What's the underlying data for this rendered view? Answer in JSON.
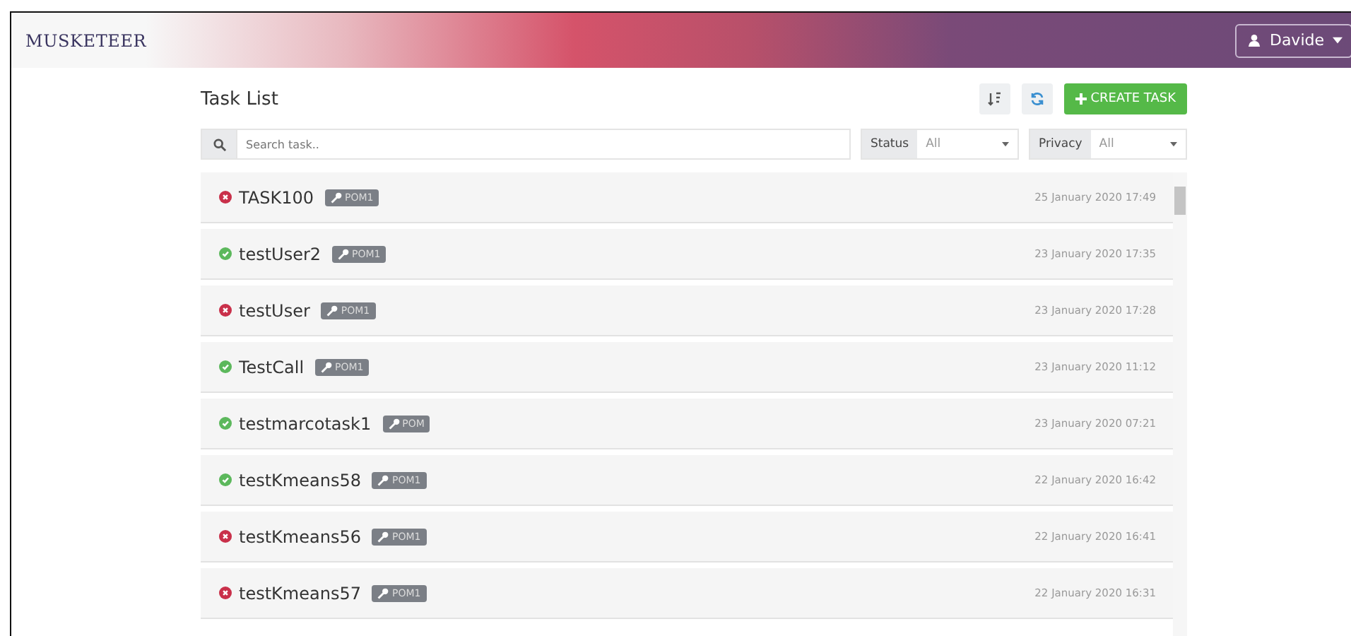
{
  "header": {
    "logo": "MUSKETEER",
    "user": "Davide"
  },
  "page": {
    "title": "Task List",
    "create_button": "CREATE TASK"
  },
  "filters": {
    "search": {
      "placeholder": "Search task.."
    },
    "status": {
      "label": "Status",
      "value": "All"
    },
    "privacy": {
      "label": "Privacy",
      "value": "All"
    }
  },
  "tasks": [
    {
      "name": "TASK100",
      "kind": "failed",
      "tag": "POM1",
      "date": "25 January 2020 17:49"
    },
    {
      "name": "testUser2",
      "kind": "done",
      "tag": "POM1",
      "date": "23 January 2020 17:35"
    },
    {
      "name": "testUser",
      "kind": "failed",
      "tag": "POM1",
      "date": "23 January 2020 17:28"
    },
    {
      "name": "TestCall",
      "kind": "done",
      "tag": "POM1",
      "date": "23 January 2020 11:12"
    },
    {
      "name": "testmarcotask1",
      "kind": "done",
      "tag": "POM",
      "date": "23 January 2020 07:21"
    },
    {
      "name": "testKmeans58",
      "kind": "done",
      "tag": "POM1",
      "date": "22 January 2020 16:42"
    },
    {
      "name": "testKmeans56",
      "kind": "failed",
      "tag": "POM1",
      "date": "22 January 2020 16:41"
    },
    {
      "name": "testKmeans57",
      "kind": "failed",
      "tag": "POM1",
      "date": "22 January 2020 16:31"
    }
  ]
}
